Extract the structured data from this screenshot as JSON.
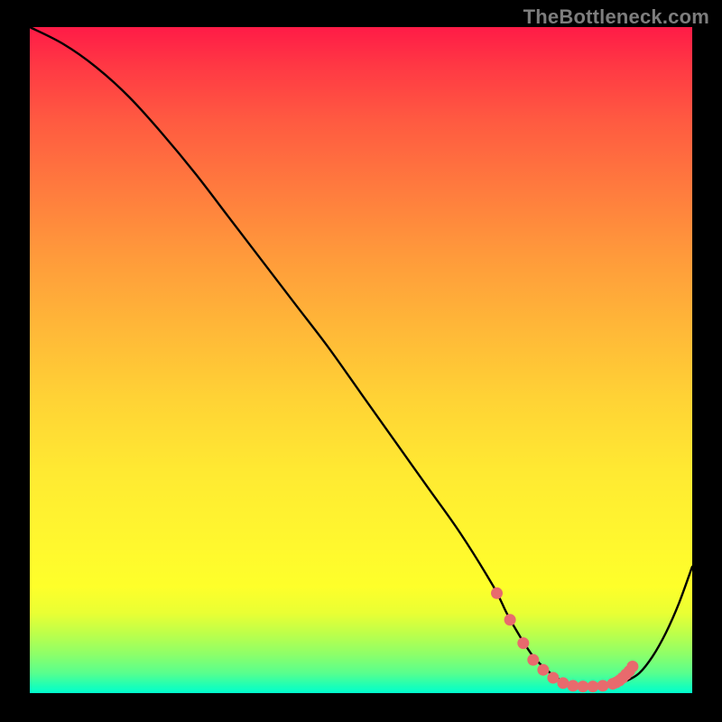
{
  "watermark": "TheBottleneck.com",
  "chart_data": {
    "type": "line",
    "title": "",
    "xlabel": "",
    "ylabel": "",
    "xlim": [
      0,
      100
    ],
    "ylim": [
      0,
      100
    ],
    "series": [
      {
        "name": "bottleneck-curve",
        "x": [
          0,
          5,
          10,
          15,
          20,
          25,
          30,
          35,
          40,
          45,
          50,
          55,
          60,
          65,
          70,
          72,
          74,
          76,
          78,
          80,
          82,
          84,
          86,
          88,
          90,
          92,
          94,
          96,
          98,
          100
        ],
        "y": [
          100,
          97.5,
          94,
          89.5,
          84,
          78,
          71.5,
          65,
          58.5,
          52,
          45,
          38,
          31,
          24,
          16,
          12,
          8.5,
          5.5,
          3.5,
          2,
          1.2,
          1,
          1,
          1.2,
          1.8,
          3,
          5.5,
          9,
          13.5,
          19
        ]
      }
    ],
    "highlight_dots": {
      "name": "valley-markers",
      "x": [
        70.5,
        72.5,
        74.5,
        76,
        77.5,
        79,
        80.5,
        82,
        83.5,
        85,
        86.5,
        88,
        88.5,
        89,
        89.5,
        90,
        90.5,
        91
      ],
      "y": [
        15,
        11,
        7.5,
        5,
        3.5,
        2.3,
        1.5,
        1.1,
        1,
        1,
        1.1,
        1.4,
        1.6,
        1.9,
        2.3,
        2.8,
        3.3,
        4
      ]
    },
    "gradient_stops": [
      {
        "pct": 0,
        "color": "#ff1b47"
      },
      {
        "pct": 50,
        "color": "#ffc936"
      },
      {
        "pct": 88,
        "color": "#f6ff2d"
      },
      {
        "pct": 100,
        "color": "#00ffce"
      }
    ]
  }
}
